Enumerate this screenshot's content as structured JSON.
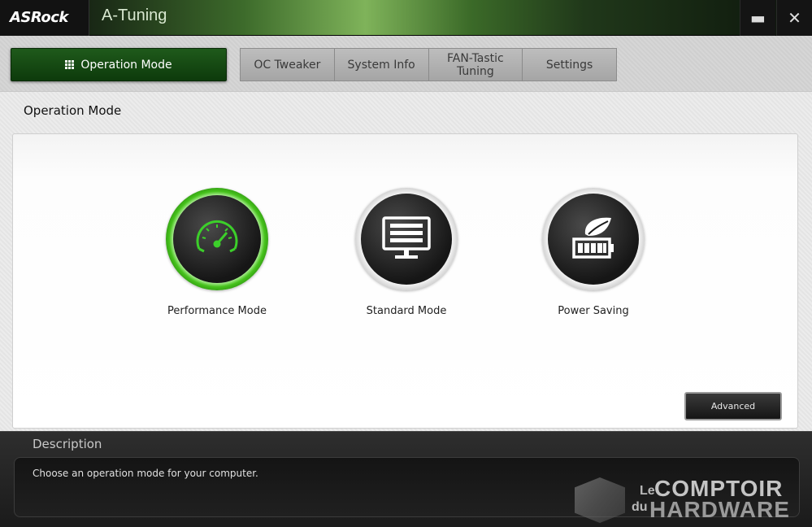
{
  "window": {
    "brand": "ASRock",
    "title": "A-Tuning",
    "minimize_icon": "minimize-icon",
    "close_icon": "close-icon"
  },
  "tabs": {
    "active": {
      "label": "Operation Mode",
      "icon": "grid-icon"
    },
    "items": [
      {
        "label": "OC Tweaker"
      },
      {
        "label": "System Info"
      },
      {
        "label": "FAN-Tastic Tuning"
      },
      {
        "label": "Settings"
      }
    ]
  },
  "main": {
    "section_title": "Operation Mode",
    "modes": [
      {
        "label": "Performance Mode",
        "icon": "speedometer-icon",
        "selected": true
      },
      {
        "label": "Standard Mode",
        "icon": "monitor-icon",
        "selected": false
      },
      {
        "label": "Power Saving",
        "icon": "leaf-battery-icon",
        "selected": false
      }
    ],
    "advanced_label": "Advanced"
  },
  "description": {
    "title": "Description",
    "text": "Choose an operation mode for your computer."
  },
  "watermark": {
    "le": "Le",
    "du": "du",
    "line1": "COMPTOIR",
    "line2": "HARDWARE"
  },
  "colors": {
    "accent_green": "#2fa31a",
    "tab_active_bg": "#1a5016",
    "dark_panel": "#1b1b1b"
  }
}
